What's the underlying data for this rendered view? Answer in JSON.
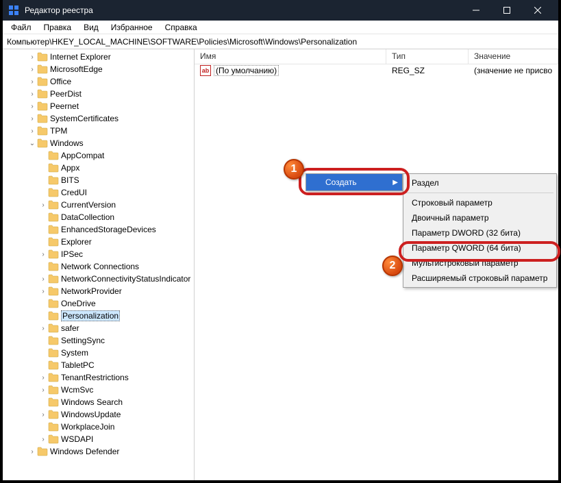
{
  "window": {
    "title": "Редактор реестра"
  },
  "menubar": [
    "Файл",
    "Правка",
    "Вид",
    "Избранное",
    "Справка"
  ],
  "path": "Компьютер\\HKEY_LOCAL_MACHINE\\SOFTWARE\\Policies\\Microsoft\\Windows\\Personalization",
  "tree": [
    {
      "label": "Internet Explorer",
      "indent": 2,
      "exp": "›"
    },
    {
      "label": "MicrosoftEdge",
      "indent": 2,
      "exp": "›"
    },
    {
      "label": "Office",
      "indent": 2,
      "exp": "›"
    },
    {
      "label": "PeerDist",
      "indent": 2,
      "exp": "›"
    },
    {
      "label": "Peernet",
      "indent": 2,
      "exp": "›"
    },
    {
      "label": "SystemCertificates",
      "indent": 2,
      "exp": "›"
    },
    {
      "label": "TPM",
      "indent": 2,
      "exp": "›"
    },
    {
      "label": "Windows",
      "indent": 2,
      "exp": "⌄"
    },
    {
      "label": "AppCompat",
      "indent": 3,
      "exp": ""
    },
    {
      "label": "Appx",
      "indent": 3,
      "exp": ""
    },
    {
      "label": "BITS",
      "indent": 3,
      "exp": ""
    },
    {
      "label": "CredUI",
      "indent": 3,
      "exp": ""
    },
    {
      "label": "CurrentVersion",
      "indent": 3,
      "exp": "›"
    },
    {
      "label": "DataCollection",
      "indent": 3,
      "exp": ""
    },
    {
      "label": "EnhancedStorageDevices",
      "indent": 3,
      "exp": ""
    },
    {
      "label": "Explorer",
      "indent": 3,
      "exp": ""
    },
    {
      "label": "IPSec",
      "indent": 3,
      "exp": "›"
    },
    {
      "label": "Network Connections",
      "indent": 3,
      "exp": ""
    },
    {
      "label": "NetworkConnectivityStatusIndicator",
      "indent": 3,
      "exp": "›"
    },
    {
      "label": "NetworkProvider",
      "indent": 3,
      "exp": "›"
    },
    {
      "label": "OneDrive",
      "indent": 3,
      "exp": ""
    },
    {
      "label": "Personalization",
      "indent": 3,
      "exp": "",
      "selected": true
    },
    {
      "label": "safer",
      "indent": 3,
      "exp": "›"
    },
    {
      "label": "SettingSync",
      "indent": 3,
      "exp": ""
    },
    {
      "label": "System",
      "indent": 3,
      "exp": ""
    },
    {
      "label": "TabletPC",
      "indent": 3,
      "exp": ""
    },
    {
      "label": "TenantRestrictions",
      "indent": 3,
      "exp": "›"
    },
    {
      "label": "WcmSvc",
      "indent": 3,
      "exp": "›"
    },
    {
      "label": "Windows Search",
      "indent": 3,
      "exp": ""
    },
    {
      "label": "WindowsUpdate",
      "indent": 3,
      "exp": "›"
    },
    {
      "label": "WorkplaceJoin",
      "indent": 3,
      "exp": ""
    },
    {
      "label": "WSDAPI",
      "indent": 3,
      "exp": "›"
    },
    {
      "label": "Windows Defender",
      "indent": 2,
      "exp": "›"
    }
  ],
  "list": {
    "headers": {
      "name": "Имя",
      "type": "Тип",
      "value": "Значение"
    },
    "rows": [
      {
        "name": "(По умолчанию)",
        "type": "REG_SZ",
        "value": "(значение не присво"
      }
    ]
  },
  "context1": {
    "create": "Создать"
  },
  "context2": {
    "items": [
      "Раздел",
      "Строковый параметр",
      "Двоичный параметр",
      "Параметр DWORD (32 бита)",
      "Параметр QWORD (64 бита)",
      "Мультистроковый параметр",
      "Расширяемый строковый параметр"
    ]
  },
  "badges": {
    "1": "1",
    "2": "2"
  }
}
